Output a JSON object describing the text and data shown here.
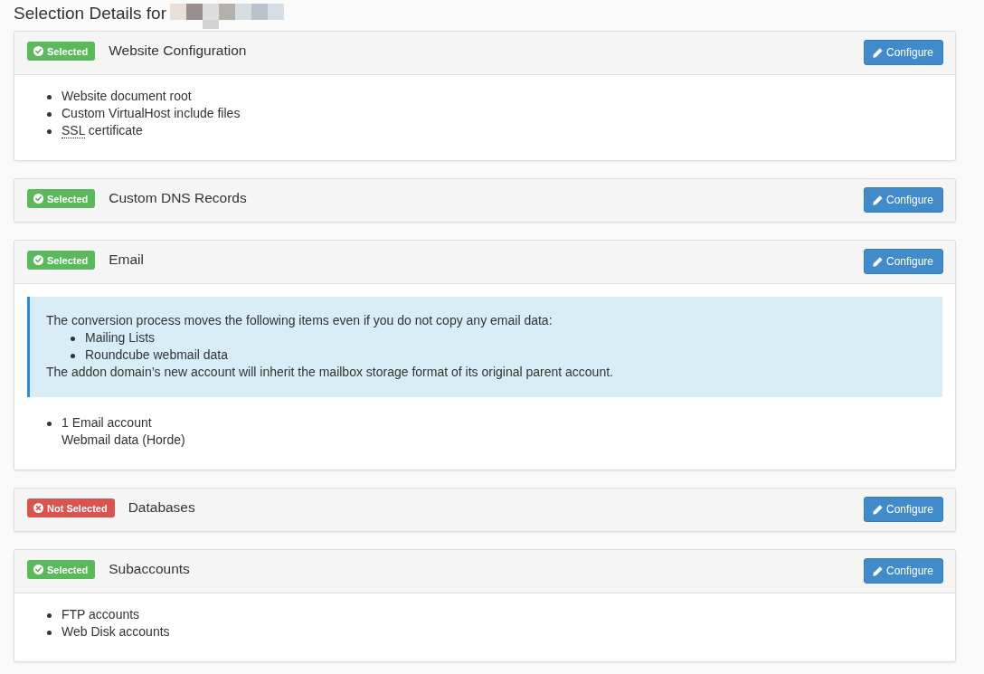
{
  "heading": "Selection Details for",
  "sections": [
    {
      "status": {
        "label": "Selected",
        "selected": true
      },
      "title": "Website Configuration",
      "button": "Configure",
      "items": [
        {
          "text": "Website document root"
        },
        {
          "text": "Custom VirtualHost include files"
        },
        {
          "abbr": "SSL",
          "text": "certificate"
        }
      ]
    },
    {
      "status": {
        "label": "Selected",
        "selected": true
      },
      "title": "Custom DNS Records",
      "button": "Configure"
    },
    {
      "status": {
        "label": "Selected",
        "selected": true
      },
      "title": "Email",
      "button": "Configure",
      "notice": {
        "intro": "The conversion process moves the following items even if you do not copy any email data:",
        "items": [
          "Mailing Lists",
          "Roundcube webmail data"
        ],
        "outro": "The addon domain’s new account will inherit the mailbox storage format of its original parent account."
      },
      "items": [
        {
          "text": "1 Email account",
          "note": "Webmail data (Horde)"
        }
      ]
    },
    {
      "status": {
        "label": "Not Selected",
        "selected": false
      },
      "title": "Databases",
      "button": "Configure"
    },
    {
      "status": {
        "label": "Selected",
        "selected": true
      },
      "title": "Subaccounts",
      "button": "Configure",
      "items": [
        {
          "text": "FTP accounts"
        },
        {
          "text": "Web Disk accounts"
        }
      ]
    }
  ]
}
